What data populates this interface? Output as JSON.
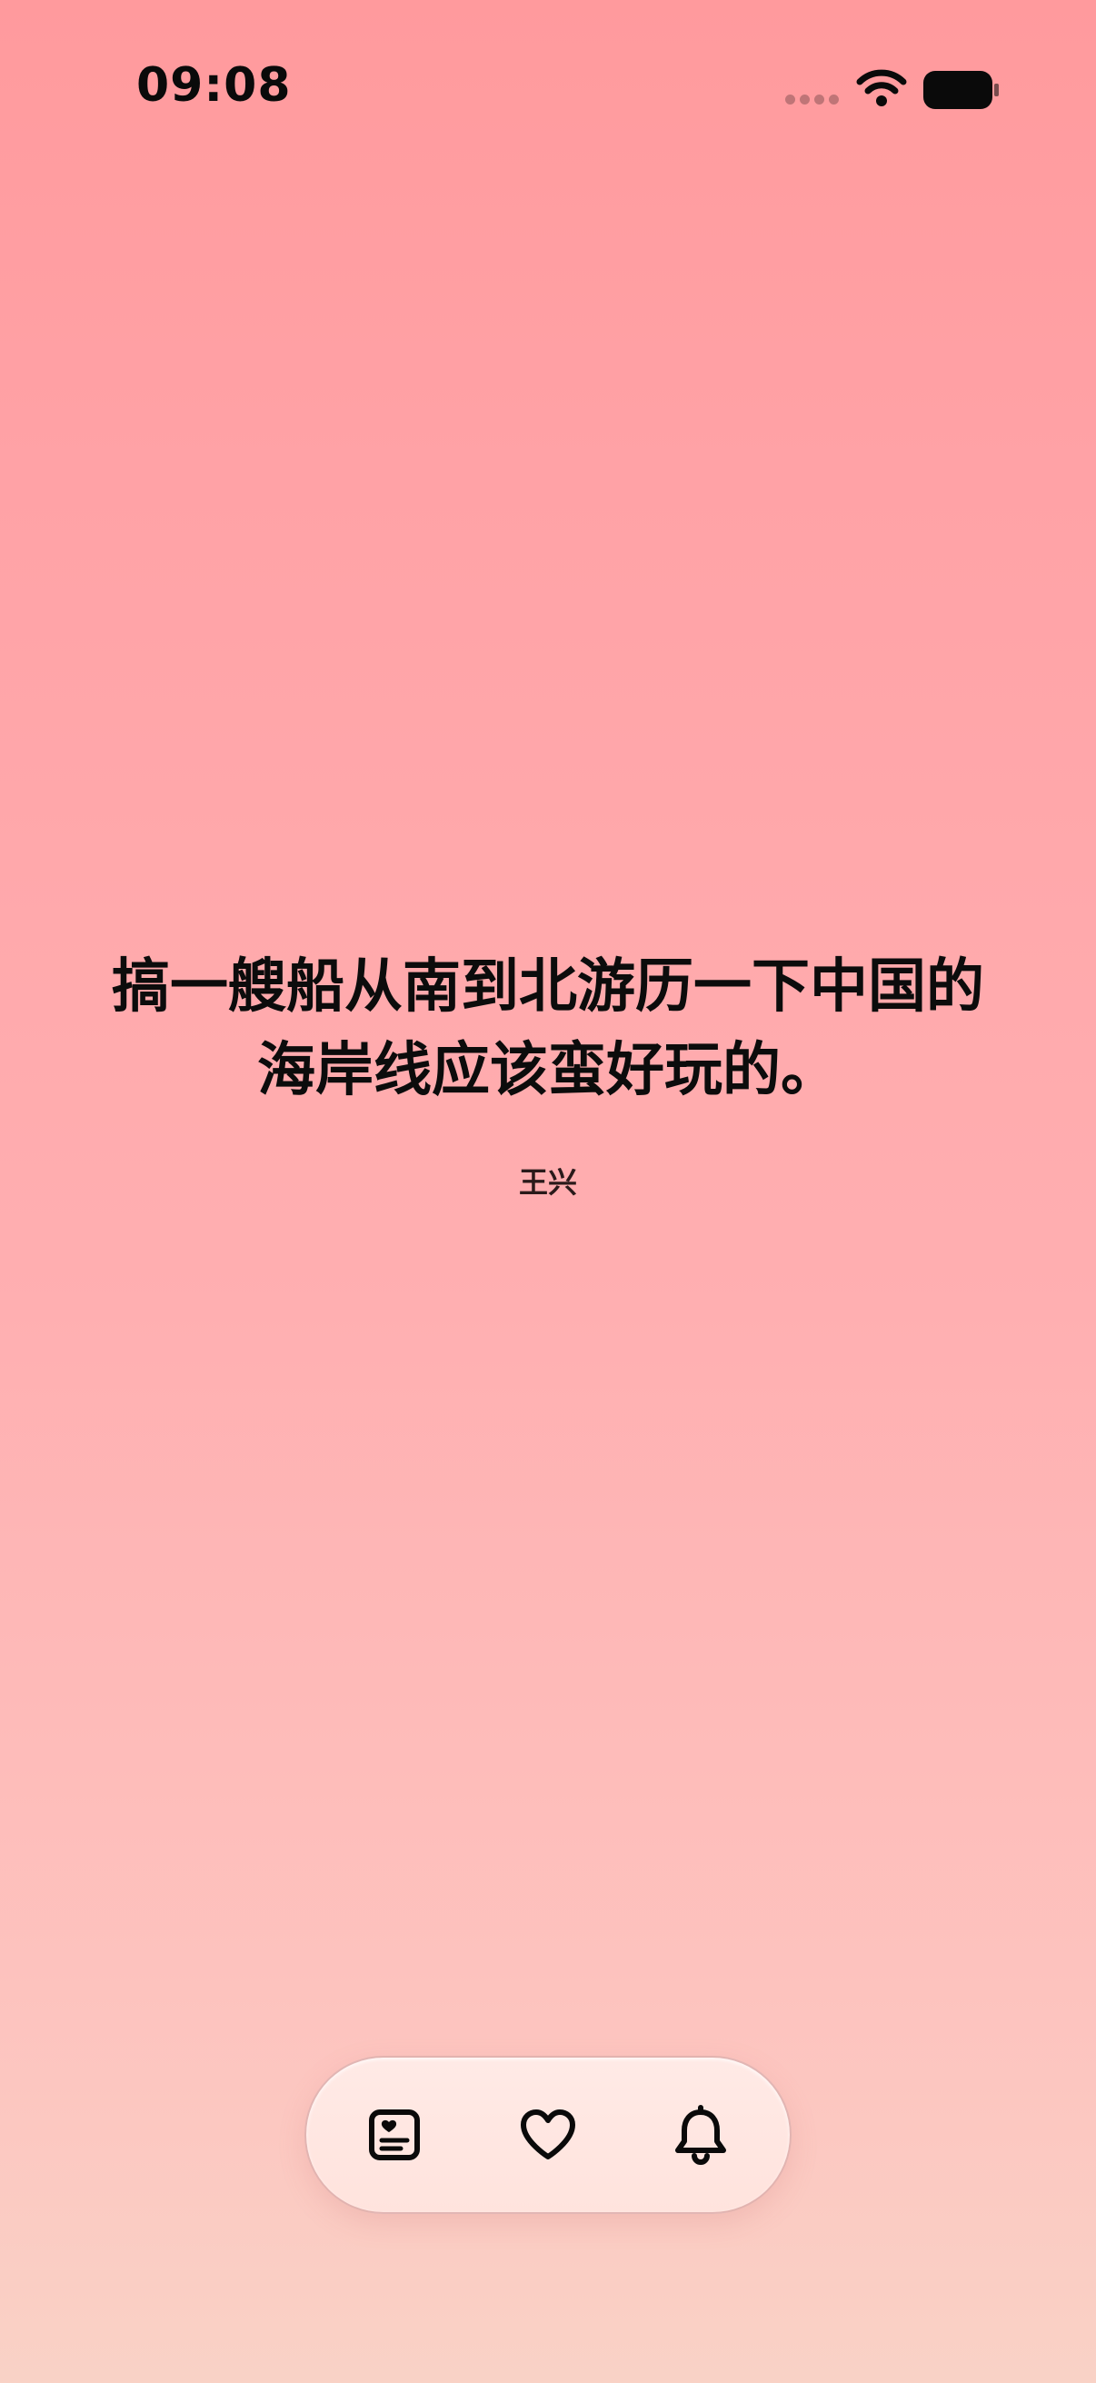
{
  "status_bar": {
    "time": "09:08",
    "icons": [
      "signal-dots-icon",
      "wifi-icon",
      "battery-icon"
    ]
  },
  "quote": {
    "text": "搞一艘船从南到北游历一下中国的海岸线应该蛮好玩的。",
    "author": "王兴"
  },
  "bottom_nav": {
    "items": [
      {
        "icon": "quote-card-icon"
      },
      {
        "icon": "heart-icon"
      },
      {
        "icon": "bell-icon"
      }
    ]
  },
  "colors": {
    "background_top": "#ff9a9d",
    "background_bottom": "#f9d2c6",
    "nav_background": "#ffe7e2",
    "text": "#0c0c0c"
  }
}
